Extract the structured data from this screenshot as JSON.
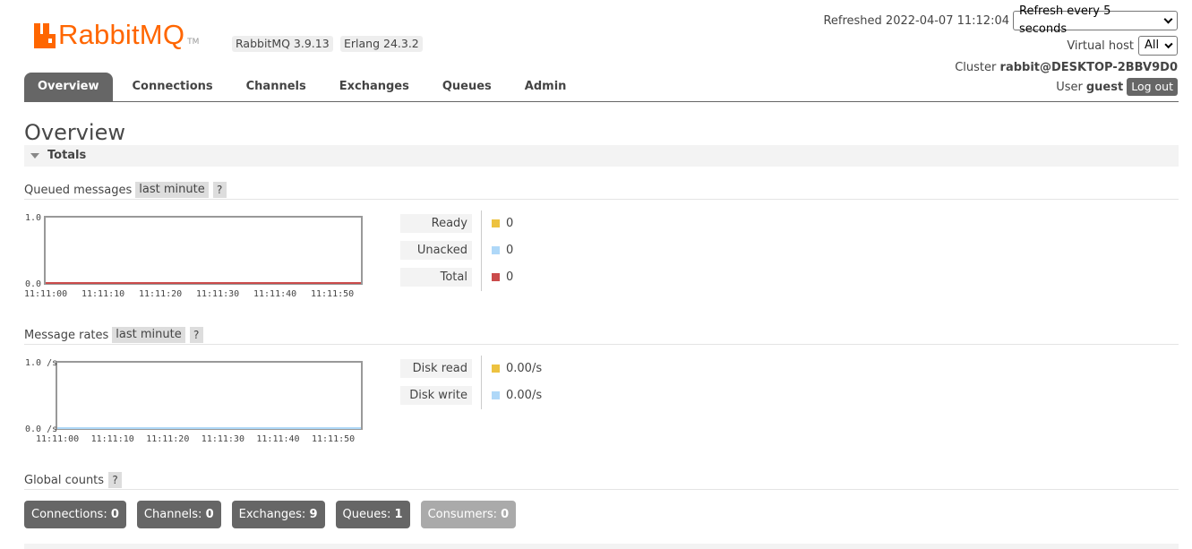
{
  "header": {
    "logo_text": "RabbitMQ",
    "logo_tm": "TM",
    "rabbitmq_version": "RabbitMQ 3.9.13",
    "erlang_version": "Erlang 24.3.2",
    "refreshed_label": "Refreshed 2022-04-07 11:12:04",
    "refresh_select": "Refresh every 5 seconds",
    "vhost_label": "Virtual host",
    "vhost_select": "All",
    "cluster_label": "Cluster",
    "cluster_name": "rabbit@DESKTOP-2BBV9D0",
    "user_label": "User",
    "user_name": "guest",
    "logout_label": "Log out"
  },
  "tabs": [
    {
      "label": "Overview",
      "active": true
    },
    {
      "label": "Connections",
      "active": false
    },
    {
      "label": "Channels",
      "active": false
    },
    {
      "label": "Exchanges",
      "active": false
    },
    {
      "label": "Queues",
      "active": false
    },
    {
      "label": "Admin",
      "active": false
    }
  ],
  "page_title": "Overview",
  "totals_label": "Totals",
  "queued": {
    "title": "Queued messages",
    "range": "last minute",
    "help": "?",
    "y_top": "1.0",
    "y_bottom": "0.0",
    "x_ticks": [
      "11:11:00",
      "11:11:10",
      "11:11:20",
      "11:11:30",
      "11:11:40",
      "11:11:50"
    ],
    "legend": [
      {
        "name": "Ready",
        "value": "0",
        "color": "#edc240"
      },
      {
        "name": "Unacked",
        "value": "0",
        "color": "#afd8f8"
      },
      {
        "name": "Total",
        "value": "0",
        "color": "#cb4b4b"
      }
    ]
  },
  "rates": {
    "title": "Message rates",
    "range": "last minute",
    "help": "?",
    "y_top": "1.0 /s",
    "y_bottom": "0.0 /s",
    "x_ticks": [
      "11:11:00",
      "11:11:10",
      "11:11:20",
      "11:11:30",
      "11:11:40",
      "11:11:50"
    ],
    "legend": [
      {
        "name": "Disk read",
        "value": "0.00/s",
        "color": "#edc240"
      },
      {
        "name": "Disk write",
        "value": "0.00/s",
        "color": "#afd8f8"
      }
    ]
  },
  "global": {
    "title": "Global counts",
    "help": "?",
    "counts": [
      {
        "label": "Connections:",
        "value": "0",
        "dim": false
      },
      {
        "label": "Channels:",
        "value": "0",
        "dim": false
      },
      {
        "label": "Exchanges:",
        "value": "9",
        "dim": false
      },
      {
        "label": "Queues:",
        "value": "1",
        "dim": false
      },
      {
        "label": "Consumers:",
        "value": "0",
        "dim": true
      }
    ]
  }
}
